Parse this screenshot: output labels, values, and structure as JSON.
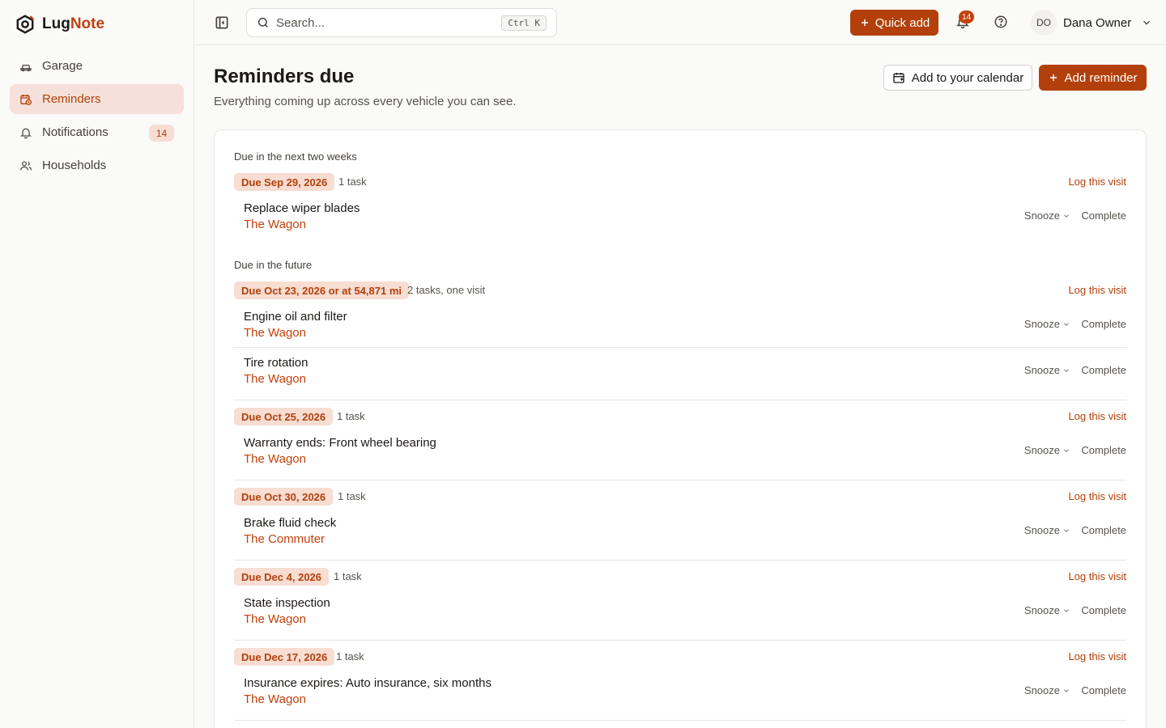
{
  "app": {
    "name_a": "Lug",
    "name_b": "Note"
  },
  "sidebar": {
    "items": [
      {
        "label": "Garage",
        "icon": "car-icon"
      },
      {
        "label": "Reminders",
        "icon": "calendar-clock-icon",
        "active": true
      },
      {
        "label": "Notifications",
        "icon": "bell-icon",
        "badge": "14"
      },
      {
        "label": "Households",
        "icon": "users-icon"
      }
    ]
  },
  "topbar": {
    "search_placeholder": "Search...",
    "search_shortcut": "Ctrl K",
    "quick_add": "Quick add",
    "notification_count": "14",
    "user_initials": "DO",
    "user_name": "Dana Owner"
  },
  "page": {
    "title": "Reminders due",
    "subtitle": "Everything coming up across every vehicle you can see.",
    "calendar_button": "Add to your calendar",
    "add_button": "Add reminder"
  },
  "actions": {
    "log": "Log this visit",
    "snooze": "Snooze",
    "complete": "Complete"
  },
  "sections": [
    {
      "label": "Due in the next two weeks",
      "groups": [
        {
          "due": "Due Sep 29, 2026",
          "count": "1 task",
          "tasks": [
            {
              "title": "Replace wiper blades",
              "vehicle": "The Wagon"
            }
          ]
        }
      ]
    },
    {
      "label": "Due in the future",
      "groups": [
        {
          "due": "Due Oct 23, 2026 or at 54,871 mi",
          "count": "2 tasks, one visit",
          "tasks": [
            {
              "title": "Engine oil and filter",
              "vehicle": "The Wagon"
            },
            {
              "title": "Tire rotation",
              "vehicle": "The Wagon"
            }
          ]
        },
        {
          "due": "Due Oct 25, 2026",
          "count": "1 task",
          "tasks": [
            {
              "title": "Warranty ends: Front wheel bearing",
              "vehicle": "The Wagon"
            }
          ]
        },
        {
          "due": "Due Oct 30, 2026",
          "count": "1 task",
          "tasks": [
            {
              "title": "Brake fluid check",
              "vehicle": "The Commuter"
            }
          ]
        },
        {
          "due": "Due Dec 4, 2026",
          "count": "1 task",
          "tasks": [
            {
              "title": "State inspection",
              "vehicle": "The Wagon"
            }
          ]
        },
        {
          "due": "Due Dec 17, 2026",
          "count": "1 task",
          "tasks": [
            {
              "title": "Insurance expires: Auto insurance, six months",
              "vehicle": "The Wagon"
            }
          ]
        }
      ]
    }
  ]
}
